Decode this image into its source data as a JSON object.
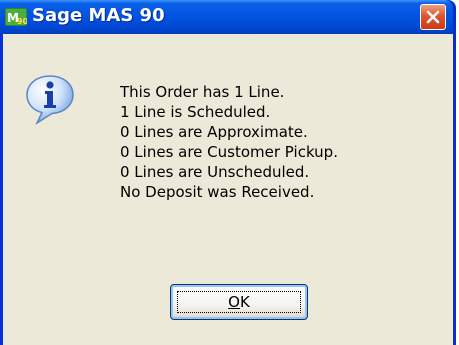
{
  "window": {
    "title": "Sage MAS 90",
    "app_icon": "mas90-app-icon",
    "close_icon": "close-icon"
  },
  "dialog": {
    "icon": "information-icon",
    "messages": [
      "This Order has 1 Line.",
      "1 Line is Scheduled.",
      "0 Lines are Approximate.",
      "0 Lines are Customer Pickup.",
      "0 Lines are Unscheduled.",
      "No Deposit was Received."
    ],
    "ok_button": {
      "accelerator": "O",
      "rest": "K"
    }
  },
  "colors": {
    "titlebar": "#0054e3",
    "client_background": "#ece9d8",
    "close_button": "#e2542e"
  }
}
